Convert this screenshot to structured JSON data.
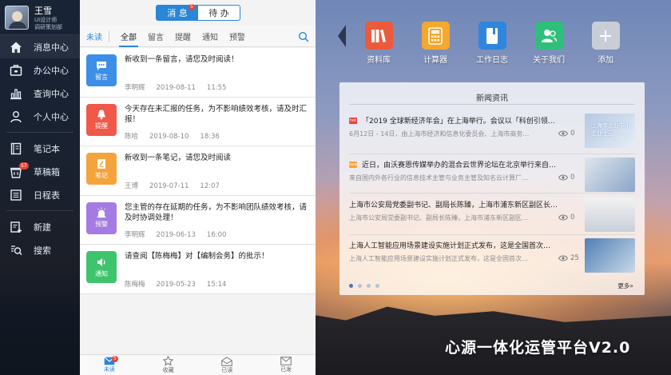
{
  "user": {
    "name": "王雪",
    "role": "UI设计师",
    "dept": "调研策划部"
  },
  "sidebar": {
    "items": [
      {
        "label": "消息中心",
        "icon": "home-icon"
      },
      {
        "label": "办公中心",
        "icon": "office-icon"
      },
      {
        "label": "查询中心",
        "icon": "chart-icon"
      },
      {
        "label": "个人中心",
        "icon": "person-icon"
      },
      {
        "label": "笔记本",
        "icon": "notebook-icon"
      },
      {
        "label": "草稿箱",
        "icon": "draft-box-icon",
        "badge": "57"
      },
      {
        "label": "日程表",
        "icon": "schedule-icon"
      },
      {
        "label": "新建",
        "icon": "new-icon"
      },
      {
        "label": "搜索",
        "icon": "search-icon"
      }
    ]
  },
  "panel": {
    "seg_on": "消 息",
    "seg_on_badge": "5",
    "seg_off": "待 办",
    "filters": [
      "未读",
      "全部",
      "留言",
      "提醒",
      "通知",
      "预警"
    ],
    "messages": [
      {
        "type": "留言",
        "color": "#3d8ee6",
        "text": "新收到一条留言，请您及时阅读！",
        "sender": "李明辉",
        "date": "2019-08-11",
        "time": "11:55"
      },
      {
        "type": "提醒",
        "color": "#f0584a",
        "text": "今天存在未汇报的任务，为不影响绩效考核，请及时汇报！",
        "sender": "陈哈",
        "date": "2019-08-10",
        "time": "18:36"
      },
      {
        "type": "笔记",
        "color": "#f5a33c",
        "text": "新收到一条笔记，请您及时阅读",
        "sender": "王博",
        "date": "2019-07-11",
        "time": "12:07"
      },
      {
        "type": "预警",
        "color": "#a47be3",
        "text": "您主管的存在延期的任务，为不影响团队绩效考核，请及时协调处理！",
        "sender": "李明辉",
        "date": "2019-06-13",
        "time": "16:00"
      },
      {
        "type": "通知",
        "color": "#3fc46e",
        "text": "请查阅【陈梅梅】对【编制会务】的批示！",
        "sender": "陈梅梅",
        "date": "2019-05-23",
        "time": "15:14"
      }
    ],
    "bottom": [
      {
        "label": "未读",
        "badge": "5"
      },
      {
        "label": "收藏"
      },
      {
        "label": "已读"
      },
      {
        "label": "已发"
      }
    ]
  },
  "apps": [
    {
      "label": "资料库",
      "color": "#ec5a3c",
      "icon": "books-icon"
    },
    {
      "label": "计算器",
      "color": "#f5a72e",
      "icon": "calculator-icon"
    },
    {
      "label": "工作日志",
      "color": "#2f86dd",
      "icon": "worklog-icon"
    },
    {
      "label": "关于我们",
      "color": "#2ec07a",
      "icon": "team-icon"
    },
    {
      "label": "添加",
      "color": "#c9ced6",
      "icon": "plus-icon"
    }
  ],
  "news": {
    "title": "新闻资讯",
    "items": [
      {
        "title": "「2019 全球新经济年会」在上海举行。会议以「科创引领…",
        "sub": "6月12日 - 14日，由上海市经济和信息化委员会、上海市商务委…",
        "count": "0",
        "tag": "hot",
        "thumb_text": "上海市企业中小企业上云"
      },
      {
        "title": "近日，由沃赛恩传媒举办的混合云世界论坛在北京举行来自…",
        "sub": "来自国内外各行业的信息技术主管与业务主管及知名云计算厂商…",
        "count": "0",
        "tag": "new"
      },
      {
        "title": "上海市公安局党委副书记、副局长陈臻，上海市浦东新区副区长…",
        "sub": "上海市公安局党委副书记、副局长陈臻，上海市浦东新区副区…",
        "count": "0"
      },
      {
        "title": "上海人工智能应用场景建设实施计划正式发布，这是全国首次…",
        "sub": "上海人工智能应用场景建设实施计划正式发布，这是全国首次…",
        "count": "25"
      }
    ],
    "more": "更多»"
  },
  "platform_title": "心源一体化运管平台V2.0"
}
